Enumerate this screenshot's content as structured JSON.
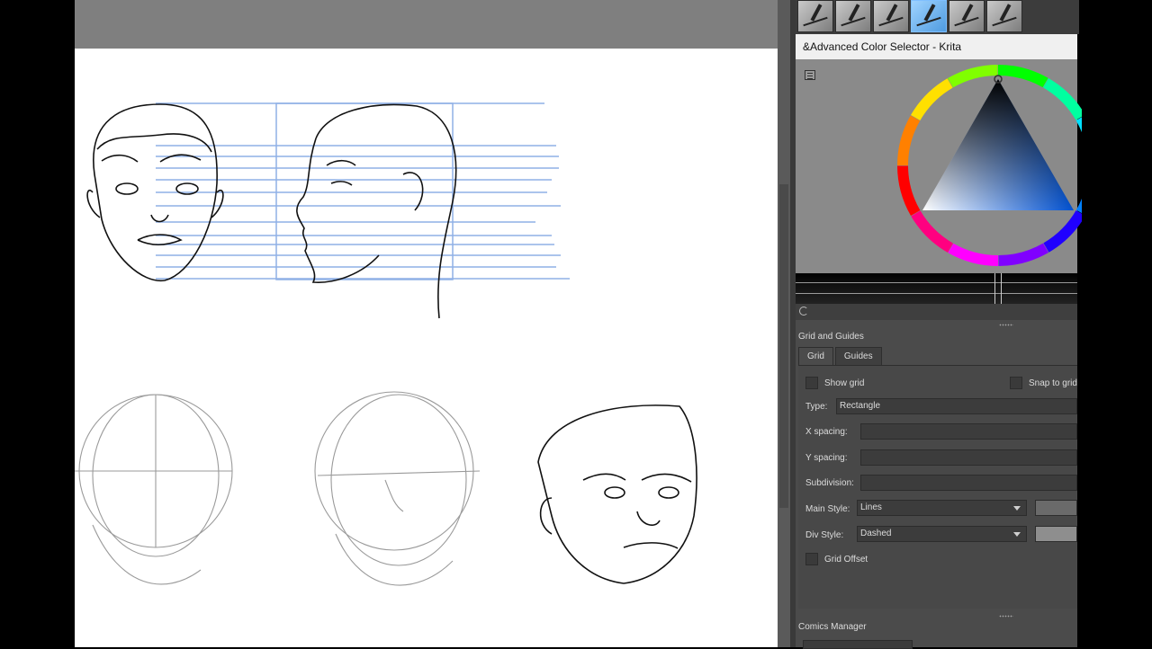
{
  "color_selector": {
    "title": "&Advanced Color Selector - Krita",
    "hue_marker_color": "#00ff00",
    "triangle_colors": [
      "#000000",
      "#0050d0",
      "#ffffff"
    ]
  },
  "brushes": [
    "pencil-preset",
    "ink-pen-preset",
    "calligraphy-pen-preset",
    "marker-preset",
    "fineliner-preset",
    "brush-pen-preset"
  ],
  "grid_guides": {
    "panel_title": "Grid and Guides",
    "tabs": [
      "Grid",
      "Guides"
    ],
    "show_grid_label": "Show grid",
    "snap_to_grid_label": "Snap to grid",
    "type_label": "Type:",
    "type_value": "Rectangle",
    "x_spacing_label": "X spacing:",
    "y_spacing_label": "Y spacing:",
    "subdivision_label": "Subdivision:",
    "main_style_label": "Main Style:",
    "main_style_value": "Lines",
    "div_style_label": "Div Style:",
    "div_style_value": "Dashed",
    "grid_offset_label": "Grid Offset"
  },
  "comics_manager": {
    "title": "Comics Manager"
  },
  "colors": {
    "docker_bg": "#4b4b4b",
    "canvas_bg": "#ffffff",
    "guide_lines": "#7fa4e0"
  }
}
